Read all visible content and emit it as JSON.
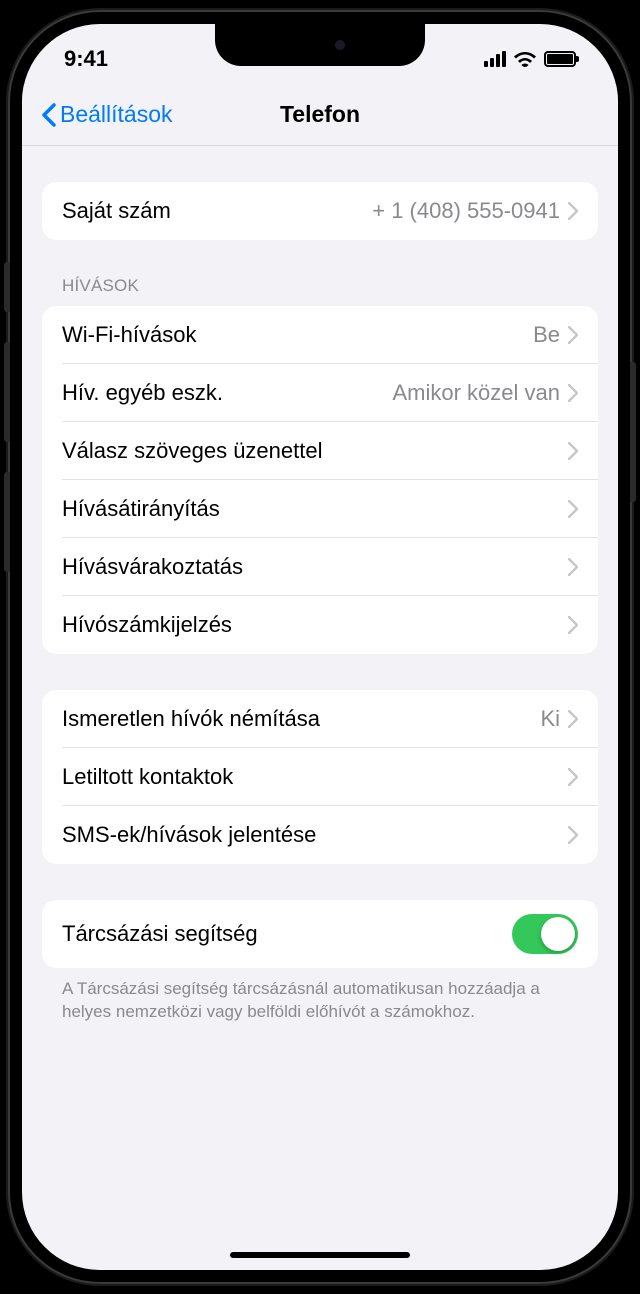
{
  "status": {
    "time": "9:41"
  },
  "nav": {
    "back_label": "Beállítások",
    "title": "Telefon"
  },
  "my_number": {
    "label": "Saját szám",
    "value": "+ 1 (408) 555-0941"
  },
  "calls": {
    "header": "HÍVÁSOK",
    "wifi_calling": {
      "label": "Wi-Fi-hívások",
      "value": "Be"
    },
    "other_devices": {
      "label": "Hív. egyéb eszk.",
      "value": "Amikor közel van"
    },
    "text_reply": {
      "label": "Válasz szöveges üzenettel"
    },
    "forwarding": {
      "label": "Hívásátirányítás"
    },
    "waiting": {
      "label": "Hívásvárakoztatás"
    },
    "caller_id": {
      "label": "Hívószámkijelzés"
    }
  },
  "blocking": {
    "silence_unknown": {
      "label": "Ismeretlen hívók némítása",
      "value": "Ki"
    },
    "blocked_contacts": {
      "label": "Letiltott kontaktok"
    },
    "report_sms": {
      "label": "SMS-ek/hívások jelentése"
    }
  },
  "dial_assist": {
    "label": "Tárcsázási segítség",
    "on": true,
    "footer": "A Tárcsázási segítség tárcsázásnál automatikusan hozzáadja a helyes nemzetközi vagy belföldi előhívót a számokhoz."
  }
}
